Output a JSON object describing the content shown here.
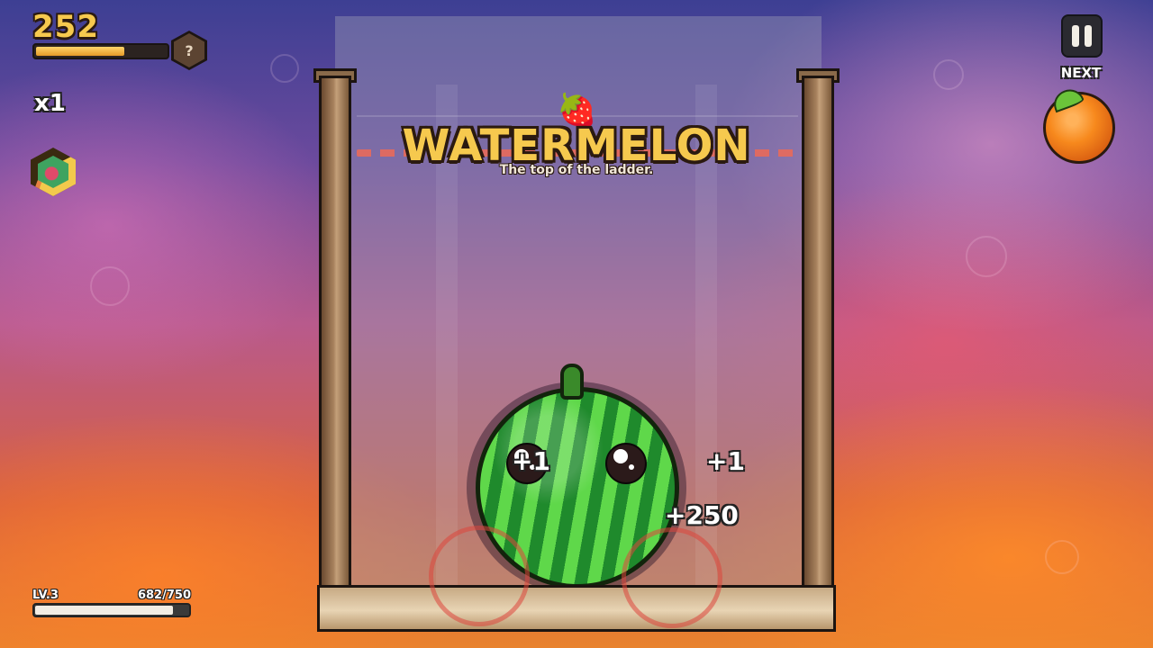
{
  "hud": {
    "score": "252",
    "score_progress": 0.66,
    "mystery_badge": "?",
    "multiplier": "x1",
    "powerup_icon": "powerup-hex-icon",
    "level_label": "LV.3",
    "xp_label": "682/750",
    "xp_progress": 0.909
  },
  "controls": {
    "pause_icon": "pause-icon",
    "next_label": "NEXT",
    "next_fruit": "orange"
  },
  "banner": {
    "icon": "🍓",
    "title": "WATERMELON",
    "subtitle": "The top of the ladder."
  },
  "board": {
    "fruit": "watermelon",
    "popups": [
      "+1",
      "+1",
      "+250"
    ]
  },
  "colors": {
    "accent_gold": "#f6c94e",
    "danger_line": "#e86a5a",
    "melon_green": "#5fd84a",
    "orange": "#f7891d"
  }
}
